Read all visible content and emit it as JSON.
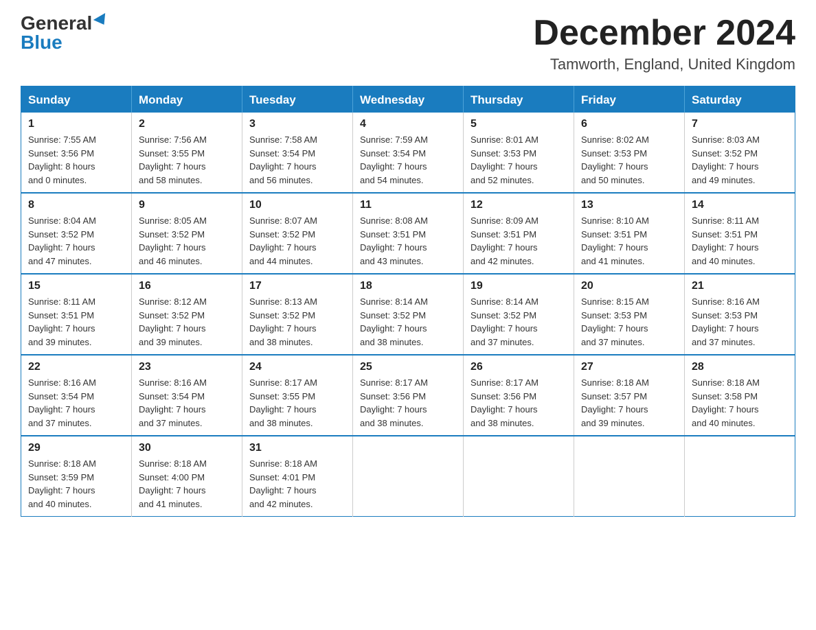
{
  "header": {
    "logo_general": "General",
    "logo_blue": "Blue",
    "title": "December 2024",
    "subtitle": "Tamworth, England, United Kingdom"
  },
  "days_of_week": [
    "Sunday",
    "Monday",
    "Tuesday",
    "Wednesday",
    "Thursday",
    "Friday",
    "Saturday"
  ],
  "weeks": [
    [
      {
        "day": "1",
        "info": "Sunrise: 7:55 AM\nSunset: 3:56 PM\nDaylight: 8 hours\nand 0 minutes."
      },
      {
        "day": "2",
        "info": "Sunrise: 7:56 AM\nSunset: 3:55 PM\nDaylight: 7 hours\nand 58 minutes."
      },
      {
        "day": "3",
        "info": "Sunrise: 7:58 AM\nSunset: 3:54 PM\nDaylight: 7 hours\nand 56 minutes."
      },
      {
        "day": "4",
        "info": "Sunrise: 7:59 AM\nSunset: 3:54 PM\nDaylight: 7 hours\nand 54 minutes."
      },
      {
        "day": "5",
        "info": "Sunrise: 8:01 AM\nSunset: 3:53 PM\nDaylight: 7 hours\nand 52 minutes."
      },
      {
        "day": "6",
        "info": "Sunrise: 8:02 AM\nSunset: 3:53 PM\nDaylight: 7 hours\nand 50 minutes."
      },
      {
        "day": "7",
        "info": "Sunrise: 8:03 AM\nSunset: 3:52 PM\nDaylight: 7 hours\nand 49 minutes."
      }
    ],
    [
      {
        "day": "8",
        "info": "Sunrise: 8:04 AM\nSunset: 3:52 PM\nDaylight: 7 hours\nand 47 minutes."
      },
      {
        "day": "9",
        "info": "Sunrise: 8:05 AM\nSunset: 3:52 PM\nDaylight: 7 hours\nand 46 minutes."
      },
      {
        "day": "10",
        "info": "Sunrise: 8:07 AM\nSunset: 3:52 PM\nDaylight: 7 hours\nand 44 minutes."
      },
      {
        "day": "11",
        "info": "Sunrise: 8:08 AM\nSunset: 3:51 PM\nDaylight: 7 hours\nand 43 minutes."
      },
      {
        "day": "12",
        "info": "Sunrise: 8:09 AM\nSunset: 3:51 PM\nDaylight: 7 hours\nand 42 minutes."
      },
      {
        "day": "13",
        "info": "Sunrise: 8:10 AM\nSunset: 3:51 PM\nDaylight: 7 hours\nand 41 minutes."
      },
      {
        "day": "14",
        "info": "Sunrise: 8:11 AM\nSunset: 3:51 PM\nDaylight: 7 hours\nand 40 minutes."
      }
    ],
    [
      {
        "day": "15",
        "info": "Sunrise: 8:11 AM\nSunset: 3:51 PM\nDaylight: 7 hours\nand 39 minutes."
      },
      {
        "day": "16",
        "info": "Sunrise: 8:12 AM\nSunset: 3:52 PM\nDaylight: 7 hours\nand 39 minutes."
      },
      {
        "day": "17",
        "info": "Sunrise: 8:13 AM\nSunset: 3:52 PM\nDaylight: 7 hours\nand 38 minutes."
      },
      {
        "day": "18",
        "info": "Sunrise: 8:14 AM\nSunset: 3:52 PM\nDaylight: 7 hours\nand 38 minutes."
      },
      {
        "day": "19",
        "info": "Sunrise: 8:14 AM\nSunset: 3:52 PM\nDaylight: 7 hours\nand 37 minutes."
      },
      {
        "day": "20",
        "info": "Sunrise: 8:15 AM\nSunset: 3:53 PM\nDaylight: 7 hours\nand 37 minutes."
      },
      {
        "day": "21",
        "info": "Sunrise: 8:16 AM\nSunset: 3:53 PM\nDaylight: 7 hours\nand 37 minutes."
      }
    ],
    [
      {
        "day": "22",
        "info": "Sunrise: 8:16 AM\nSunset: 3:54 PM\nDaylight: 7 hours\nand 37 minutes."
      },
      {
        "day": "23",
        "info": "Sunrise: 8:16 AM\nSunset: 3:54 PM\nDaylight: 7 hours\nand 37 minutes."
      },
      {
        "day": "24",
        "info": "Sunrise: 8:17 AM\nSunset: 3:55 PM\nDaylight: 7 hours\nand 38 minutes."
      },
      {
        "day": "25",
        "info": "Sunrise: 8:17 AM\nSunset: 3:56 PM\nDaylight: 7 hours\nand 38 minutes."
      },
      {
        "day": "26",
        "info": "Sunrise: 8:17 AM\nSunset: 3:56 PM\nDaylight: 7 hours\nand 38 minutes."
      },
      {
        "day": "27",
        "info": "Sunrise: 8:18 AM\nSunset: 3:57 PM\nDaylight: 7 hours\nand 39 minutes."
      },
      {
        "day": "28",
        "info": "Sunrise: 8:18 AM\nSunset: 3:58 PM\nDaylight: 7 hours\nand 40 minutes."
      }
    ],
    [
      {
        "day": "29",
        "info": "Sunrise: 8:18 AM\nSunset: 3:59 PM\nDaylight: 7 hours\nand 40 minutes."
      },
      {
        "day": "30",
        "info": "Sunrise: 8:18 AM\nSunset: 4:00 PM\nDaylight: 7 hours\nand 41 minutes."
      },
      {
        "day": "31",
        "info": "Sunrise: 8:18 AM\nSunset: 4:01 PM\nDaylight: 7 hours\nand 42 minutes."
      },
      {
        "day": "",
        "info": ""
      },
      {
        "day": "",
        "info": ""
      },
      {
        "day": "",
        "info": ""
      },
      {
        "day": "",
        "info": ""
      }
    ]
  ]
}
